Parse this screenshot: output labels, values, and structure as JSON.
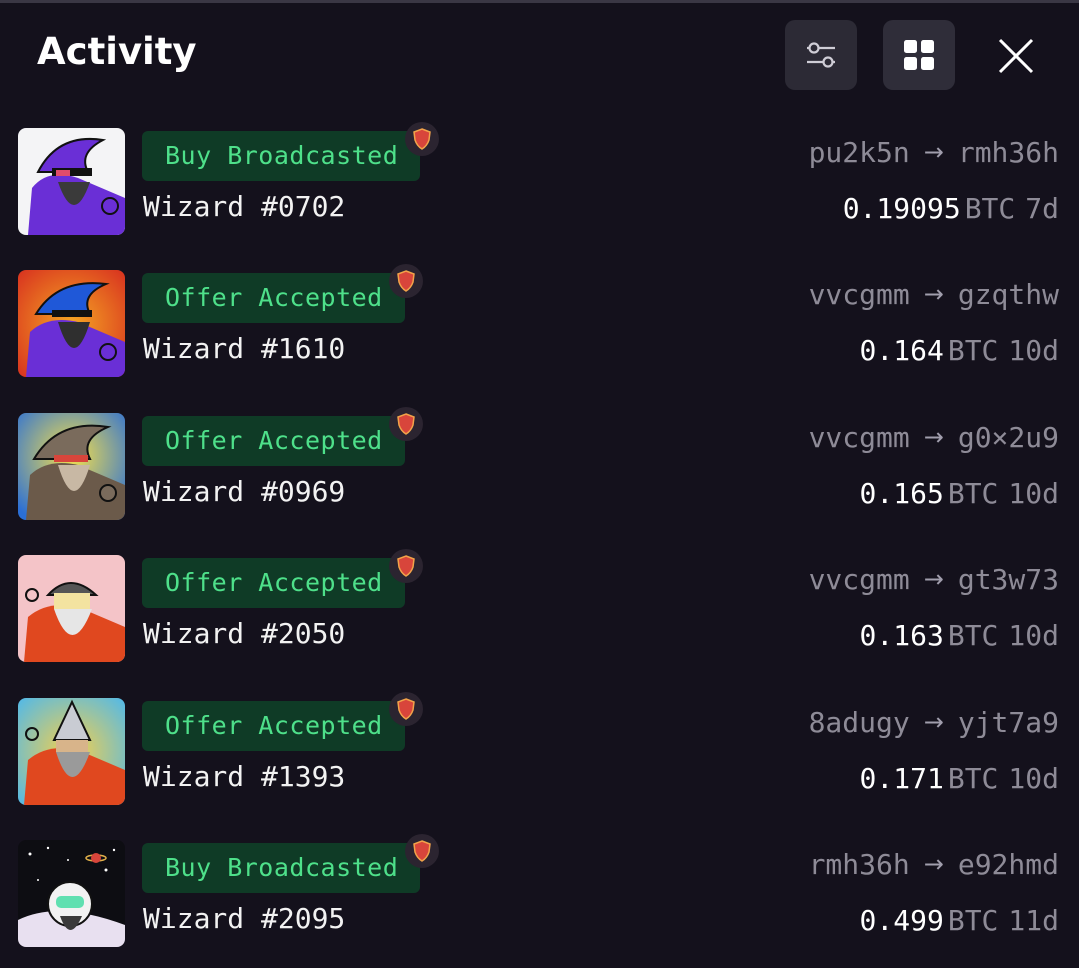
{
  "header": {
    "title": "Activity",
    "filter_icon": "sliders-icon",
    "grid_icon": "grid-icon",
    "close_icon": "close-icon"
  },
  "colors": {
    "background": "#14111c",
    "badge_bg": "#0f3b26",
    "badge_text": "#4ee08a",
    "muted": "#8e8b97",
    "shield": "#d8453b"
  },
  "activities": [
    {
      "status": "Buy Broadcasted",
      "name": "Wizard #0702",
      "from": "pu2k5n",
      "to": "rmh36h",
      "amount": "0.19095",
      "currency": "BTC",
      "age": "7d"
    },
    {
      "status": "Offer Accepted",
      "name": "Wizard #1610",
      "from": "vvcgmm",
      "to": "gzqthw",
      "amount": "0.164",
      "currency": "BTC",
      "age": "10d"
    },
    {
      "status": "Offer Accepted",
      "name": "Wizard #0969",
      "from": "vvcgmm",
      "to": "g0×2u9",
      "amount": "0.165",
      "currency": "BTC",
      "age": "10d"
    },
    {
      "status": "Offer Accepted",
      "name": "Wizard #2050",
      "from": "vvcgmm",
      "to": "gt3w73",
      "amount": "0.163",
      "currency": "BTC",
      "age": "10d"
    },
    {
      "status": "Offer Accepted",
      "name": "Wizard #1393",
      "from": "8adugy",
      "to": "yjt7a9",
      "amount": "0.171",
      "currency": "BTC",
      "age": "10d"
    },
    {
      "status": "Buy Broadcasted",
      "name": "Wizard #2095",
      "from": "rmh36h",
      "to": "e92hmd",
      "amount": "0.499",
      "currency": "BTC",
      "age": "11d"
    }
  ]
}
